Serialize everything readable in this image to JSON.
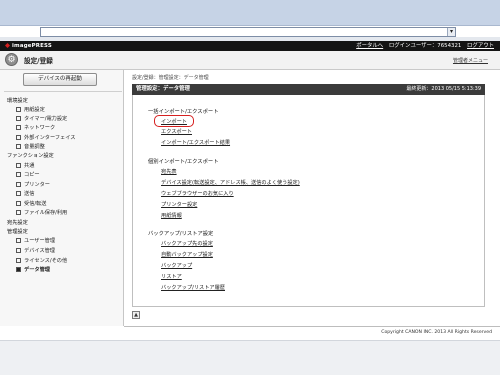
{
  "browser": {
    "dropdown_glyph": "▾"
  },
  "header": {
    "logo": "imagePRESS",
    "portal_link": "ポータルへ",
    "login_user_label": "ログインユーザー：",
    "login_user_id": "7654321",
    "logout_link": "ログアウト"
  },
  "title_bar": {
    "title": "設定/登録",
    "manager_menu": "管理者メニュー"
  },
  "sidebar": {
    "restart_button": "デバイスの再起動",
    "items": [
      {
        "label": "環境設定",
        "kind": "cat"
      },
      {
        "label": "用紙設定",
        "kind": "child"
      },
      {
        "label": "タイマー/電力設定",
        "kind": "child"
      },
      {
        "label": "ネットワーク",
        "kind": "child"
      },
      {
        "label": "外部インターフェイス",
        "kind": "child"
      },
      {
        "label": "音量調整",
        "kind": "child"
      },
      {
        "label": "ファンクション設定",
        "kind": "cat"
      },
      {
        "label": "共通",
        "kind": "child"
      },
      {
        "label": "コピー",
        "kind": "child"
      },
      {
        "label": "プリンター",
        "kind": "child"
      },
      {
        "label": "送信",
        "kind": "child"
      },
      {
        "label": "受信/転送",
        "kind": "child"
      },
      {
        "label": "ファイル保存/利用",
        "kind": "child"
      },
      {
        "label": "宛先設定",
        "kind": "cat"
      },
      {
        "label": "管理設定",
        "kind": "cat"
      },
      {
        "label": "ユーザー管理",
        "kind": "child"
      },
      {
        "label": "デバイス管理",
        "kind": "child"
      },
      {
        "label": "ライセンス/その他",
        "kind": "child"
      },
      {
        "label": "データ管理",
        "kind": "child-active"
      }
    ]
  },
  "content": {
    "breadcrumb": "設定/登録：管理設定：データ管理",
    "panel_title": "管理設定：データ管理",
    "last_updated": "最終更新：2013 05/15 5:13:39",
    "sections": [
      {
        "heading": "一括インポート/エクスポート",
        "links": [
          "インポート",
          "エクスポート",
          "インポート/エクスポート結果"
        ]
      },
      {
        "heading": "個別インポート/エクスポート",
        "links": [
          "宛先表",
          "デバイス設定(転送設定、アドレス帳、送信のよく使う設定)",
          "ウェブブラウザーのお気に入り",
          "プリンター設定",
          "用紙情報"
        ]
      },
      {
        "heading": "バックアップ/リストア設定",
        "links": [
          "バックアップ先の設定",
          "自動バックアップ設定",
          "バックアップ",
          "リストア",
          "バックアップ/リストア履歴"
        ]
      }
    ]
  },
  "footer": {
    "scroll_top_glyph": "▲",
    "copyright": "Copyright CANON INC. 2013 All Rights Reserved"
  }
}
